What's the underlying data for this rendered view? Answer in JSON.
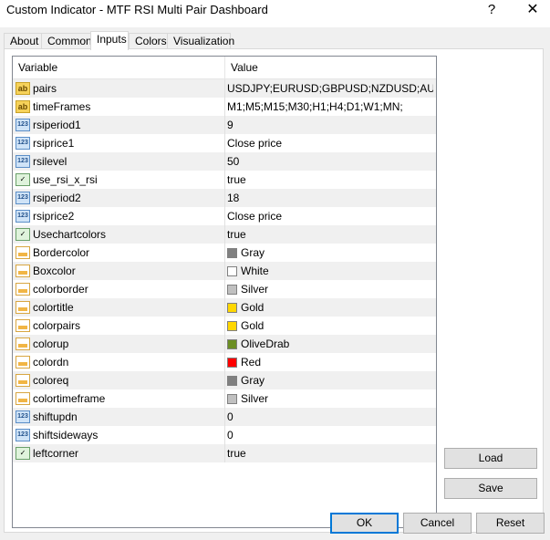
{
  "window": {
    "title": "Custom Indicator - MTF RSI Multi Pair Dashboard",
    "help_glyph": "?",
    "close_glyph": "✕"
  },
  "tabs": [
    {
      "label": "About"
    },
    {
      "label": "Common"
    },
    {
      "label": "Inputs"
    },
    {
      "label": "Colors"
    },
    {
      "label": "Visualization"
    }
  ],
  "active_tab": "Inputs",
  "grid": {
    "header_variable": "Variable",
    "header_value": "Value",
    "rows": [
      {
        "type": "string",
        "name": "pairs",
        "value": "USDJPY;EURUSD;GBPUSD;NZDUSD;AUD..."
      },
      {
        "type": "string",
        "name": "timeFrames",
        "value": "M1;M5;M15;M30;H1;H4;D1;W1;MN;"
      },
      {
        "type": "int",
        "name": "rsiperiod1",
        "value": "9"
      },
      {
        "type": "int",
        "name": "rsiprice1",
        "value": "Close price"
      },
      {
        "type": "int",
        "name": "rsilevel",
        "value": "50"
      },
      {
        "type": "bool",
        "name": "use_rsi_x_rsi",
        "value": "true"
      },
      {
        "type": "int",
        "name": "rsiperiod2",
        "value": "18"
      },
      {
        "type": "int",
        "name": "rsiprice2",
        "value": "Close price"
      },
      {
        "type": "bool",
        "name": "Usechartcolors",
        "value": "true"
      },
      {
        "type": "color",
        "name": "Bordercolor",
        "value": "Gray",
        "swatch": "#808080"
      },
      {
        "type": "color",
        "name": "Boxcolor",
        "value": "White",
        "swatch": "#ffffff"
      },
      {
        "type": "color",
        "name": "colorborder",
        "value": "Silver",
        "swatch": "#c0c0c0"
      },
      {
        "type": "color",
        "name": "colortitle",
        "value": "Gold",
        "swatch": "#ffd700"
      },
      {
        "type": "color",
        "name": "colorpairs",
        "value": "Gold",
        "swatch": "#ffd700"
      },
      {
        "type": "color",
        "name": "colorup",
        "value": "OliveDrab",
        "swatch": "#6b8e23"
      },
      {
        "type": "color",
        "name": "colordn",
        "value": "Red",
        "swatch": "#ff0000"
      },
      {
        "type": "color",
        "name": "coloreq",
        "value": "Gray",
        "swatch": "#808080"
      },
      {
        "type": "color",
        "name": "colortimeframe",
        "value": "Silver",
        "swatch": "#c0c0c0"
      },
      {
        "type": "int",
        "name": "shiftupdn",
        "value": "0"
      },
      {
        "type": "int",
        "name": "shiftsideways",
        "value": "0"
      },
      {
        "type": "bool",
        "name": "leftcorner",
        "value": "true"
      }
    ]
  },
  "buttons": {
    "load": "Load",
    "save": "Save",
    "ok": "OK",
    "cancel": "Cancel",
    "reset": "Reset"
  }
}
